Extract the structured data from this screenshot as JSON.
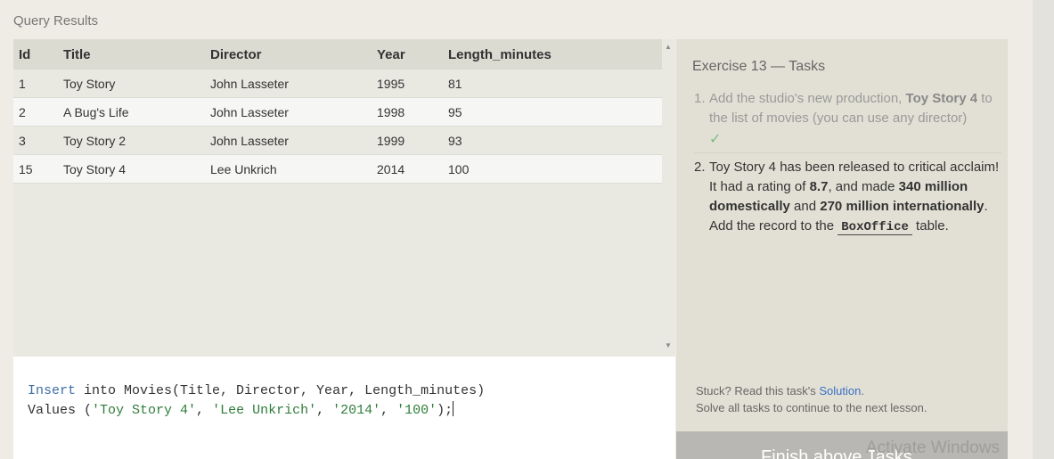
{
  "query_results": {
    "label": "Query Results",
    "columns": [
      "Id",
      "Title",
      "Director",
      "Year",
      "Length_minutes"
    ],
    "rows": [
      [
        "1",
        "Toy Story",
        "John Lasseter",
        "1995",
        "81"
      ],
      [
        "2",
        "A Bug's Life",
        "John Lasseter",
        "1998",
        "95"
      ],
      [
        "3",
        "Toy Story 2",
        "John Lasseter",
        "1999",
        "93"
      ],
      [
        "15",
        "Toy Story 4",
        "Lee Unkrich",
        "2014",
        "100"
      ]
    ]
  },
  "editor": {
    "line1": {
      "keyword": "Insert",
      "rest": " into Movies(Title, Director, Year, Length_minutes)"
    },
    "line2": {
      "prefix": "Values (",
      "v1": "'Toy Story 4'",
      "sep1": ", ",
      "v2": "'Lee Unkrich'",
      "sep2": ", ",
      "v3": "'2014'",
      "sep3": ", ",
      "v4": "'100'",
      "suffix": ");"
    }
  },
  "tasks": {
    "title": "Exercise 13 — Tasks",
    "task1": {
      "number": "1.",
      "text_a": "Add the studio's new production, ",
      "bold": "Toy Story 4",
      "text_b": " to the list of movies (you can use any director)",
      "check": "✓"
    },
    "task2": {
      "number": "2.",
      "t1": "Toy Story 4 has been released to critical acclaim! It had a rating of ",
      "b1": "8.7",
      "t2": ", and made ",
      "b2": "340 million domestically",
      "t3": " and ",
      "b3": "270 million internationally",
      "t4": ". Add the record to the ",
      "code": "BoxOffice",
      "t5": " table."
    },
    "stuck_text": "Stuck? Read this task's ",
    "solution_link": "Solution",
    "stuck_end": ".",
    "solve_text": "Solve all tasks to continue to the next lesson.",
    "finish_button": "Finish above Tasks"
  },
  "os_watermark": "Activate Windows",
  "colors": {
    "keyword": "#3e6fa6",
    "string": "#2f7d3a",
    "link": "#3a6fc4",
    "check": "#7dbb7d"
  }
}
